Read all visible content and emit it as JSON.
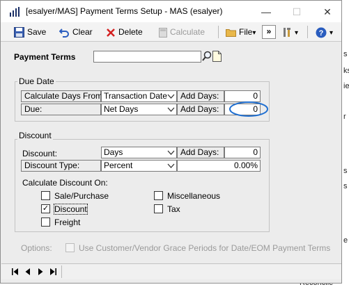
{
  "window": {
    "title": "[esalyer/MAS] Payment Terms Setup  -  MAS (esalyer)",
    "minimize_glyph": "—",
    "maximize_glyph": "☐",
    "close_glyph": "✕"
  },
  "toolbar": {
    "save_label": "Save",
    "clear_label": "Clear",
    "delete_label": "Delete",
    "calculate_label": "Calculate",
    "file_label": "File",
    "file_arrow": "▾",
    "more_glyph": "»",
    "help_arrow": "▾"
  },
  "payment_terms": {
    "label": "Payment Terms",
    "value": ""
  },
  "due_date": {
    "group_title": "Due Date",
    "calc_from_label": "Calculate Days From:",
    "calc_from_value": "Transaction Date",
    "add_days_label": "Add Days:",
    "add_days_1": "0",
    "due_label": "Due:",
    "due_value": "Net Days",
    "add_days_2": "0"
  },
  "discount": {
    "group_title": "Discount",
    "discount_label": "Discount:",
    "discount_value": "Days",
    "add_days_label": "Add Days:",
    "add_days_value": "0",
    "type_label": "Discount Type:",
    "type_value": "Percent",
    "amount_value": "0.00%",
    "calc_on_label": "Calculate Discount On:",
    "options": [
      {
        "label": "Sale/Purchase",
        "checked": false
      },
      {
        "label": "Miscellaneous",
        "checked": false
      },
      {
        "label": "Discount",
        "checked": true
      },
      {
        "label": "Tax",
        "checked": false
      },
      {
        "label": "Freight",
        "checked": false
      }
    ],
    "check_glyph": "✓"
  },
  "options": {
    "label": "Options:",
    "grace_label": "Use Customer/Vendor Grace Periods for Date/EOM Payment Terms"
  },
  "nav": {
    "first": "|◀",
    "prev": "◀",
    "next": "▶",
    "last": "▶|"
  },
  "background_text": [
    "s",
    "ks",
    "ie",
    "r",
    "s",
    "s",
    "e",
    "Reconcile"
  ],
  "colors": {
    "annotation_circle": "#1f6fd1",
    "save_icon": "#3a5fb0",
    "delete_icon": "#d42020",
    "help_icon": "#2a5dbf"
  }
}
